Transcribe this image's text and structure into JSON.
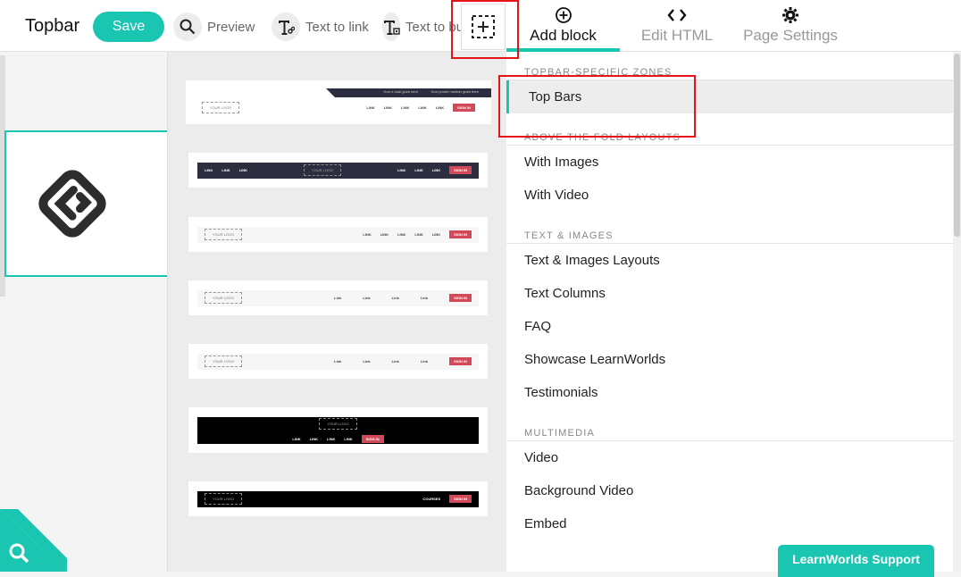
{
  "header": {
    "title": "Topbar",
    "save_label": "Save",
    "preview_label": "Preview",
    "text_to_link_label": "Text to link",
    "text_to_button_label": "Text to button"
  },
  "tabs": [
    {
      "label": "Add block",
      "icon": "plus-circle-icon"
    },
    {
      "label": "Edit HTML",
      "icon": "code-icon"
    },
    {
      "label": "Page Settings",
      "icon": "gear-icon"
    }
  ],
  "thumbnails": [
    {
      "logo": "YOUR LOGO",
      "links": [
        "LINK",
        "LINK",
        "LINK",
        "LINK",
        "LINK"
      ],
      "signin": "SIGN IN",
      "top_note_1": "Your e-mail goes here",
      "top_note_2": "Your phone number goes here"
    },
    {
      "logo": "YOUR LOGO",
      "links_left": [
        "LINK",
        "LINK",
        "LINK"
      ],
      "links": [
        "LINK",
        "LINK",
        "LINK"
      ],
      "signin": "SIGN IN"
    },
    {
      "logo": "YOUR LOGO",
      "links": [
        "LINK",
        "LINK",
        "LINK",
        "LINK",
        "LINK"
      ],
      "signin": "SIGN IN"
    },
    {
      "logo": "YOUR LOGO",
      "links": [
        "Link",
        "Link",
        "Link",
        "Link"
      ],
      "signin": "SIGN IN"
    },
    {
      "logo": "YOUR LOGO",
      "links": [
        "Link",
        "Link",
        "Link",
        "Link"
      ],
      "signin": "SIGN IN"
    },
    {
      "logo": "YOUR LOGO",
      "links": [
        "LINK",
        "LINK",
        "LINK",
        "LINK"
      ],
      "signin": "SIGN IN"
    },
    {
      "logo": "YOUR LOGO",
      "links": [
        "COURSES"
      ],
      "signin": "SIGN IN"
    }
  ],
  "categories": [
    {
      "header": "TOPBAR-SPECIFIC ZONES",
      "items": [
        "Top Bars"
      ]
    },
    {
      "header": "ABOVE THE FOLD LAYOUTS",
      "items": [
        "With Images",
        "With Video"
      ]
    },
    {
      "header": "TEXT & IMAGES",
      "items": [
        "Text & Images Layouts",
        "Text Columns",
        "FAQ",
        "Showcase LearnWorlds",
        "Testimonials"
      ]
    },
    {
      "header": "MULTIMEDIA",
      "items": [
        "Video",
        "Background Video",
        "Embed"
      ]
    }
  ],
  "active_category": "Top Bars",
  "support_label": "LearnWorlds Support",
  "colors": {
    "accent": "#1ac6b1",
    "highlight": "#e5141b",
    "signin": "#d24a5a"
  }
}
